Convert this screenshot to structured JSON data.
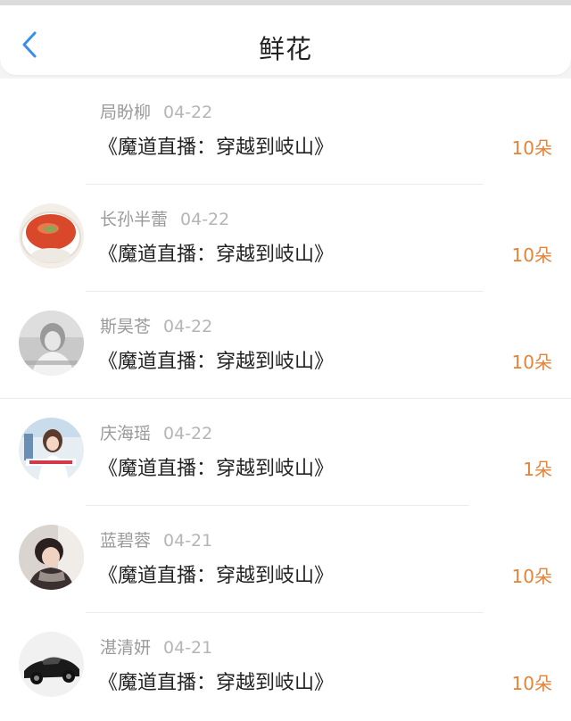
{
  "header": {
    "title": "鲜花",
    "back_icon": "chevron-left-icon",
    "accent_color": "#3d8ee8"
  },
  "items": [
    {
      "name": "局盼柳",
      "date": "04-22",
      "book": "《魔道直播：穿越到岐山》",
      "count": "10朵",
      "avatar": "none"
    },
    {
      "name": "长孙半蕾",
      "date": "04-22",
      "book": "《魔道直播：穿越到岐山》",
      "count": "10朵",
      "avatar": "tomato-soup-photo"
    },
    {
      "name": "斯昊苍",
      "date": "04-22",
      "book": "《魔道直播：穿越到岐山》",
      "count": "10朵",
      "avatar": "grayscale-girl-photo"
    },
    {
      "name": "庆海瑶",
      "date": "04-22",
      "book": "《魔道直播：穿越到岐山》",
      "count": "1朵",
      "avatar": "girl-photo"
    },
    {
      "name": "蓝碧蓉",
      "date": "04-21",
      "book": "《魔道直播：穿越到岐山》",
      "count": "10朵",
      "avatar": "boy-photo"
    },
    {
      "name": "湛清妍",
      "date": "04-21",
      "book": "《魔道直播：穿越到岐山》",
      "count": "10朵",
      "avatar": "black-car-photo"
    }
  ],
  "colors": {
    "count": "#e2833a",
    "name": "#9a9a9a",
    "text": "#222222"
  }
}
